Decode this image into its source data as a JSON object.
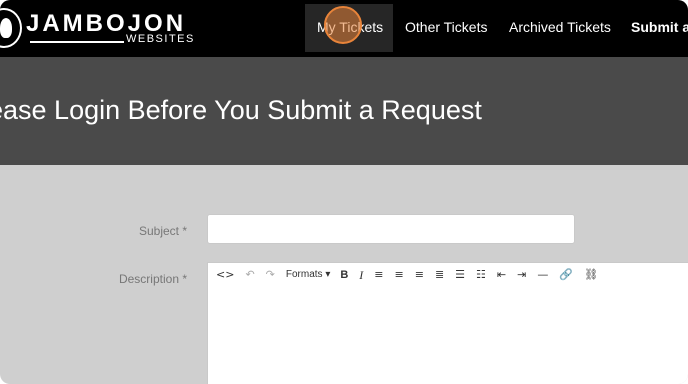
{
  "header": {
    "brand": "JAMBOJON",
    "brand_sub": "WEBSITES",
    "nav": {
      "my_tickets": "My Tickets",
      "other_tickets": "Other Tickets",
      "archived_tickets": "Archived Tickets",
      "submit": "Submit a"
    }
  },
  "hero": {
    "title": "ease Login Before You Submit a Request"
  },
  "form": {
    "subject_label": "Subject *",
    "subject_value": "",
    "description_label": "Description *"
  },
  "toolbar": {
    "source_code": "<>",
    "undo": "↶",
    "redo": "↷",
    "formats": "Formats ▾",
    "bold": "B",
    "italic": "I",
    "align_left": "≡",
    "align_center": "≡",
    "align_right": "≡",
    "align_justify": "≣",
    "bullet_list": "☰",
    "numbered_list": "☷",
    "outdent": "⇤",
    "indent": "⇥",
    "horizontal_rule": "—",
    "link": "🔗",
    "unlink": "⛓"
  }
}
